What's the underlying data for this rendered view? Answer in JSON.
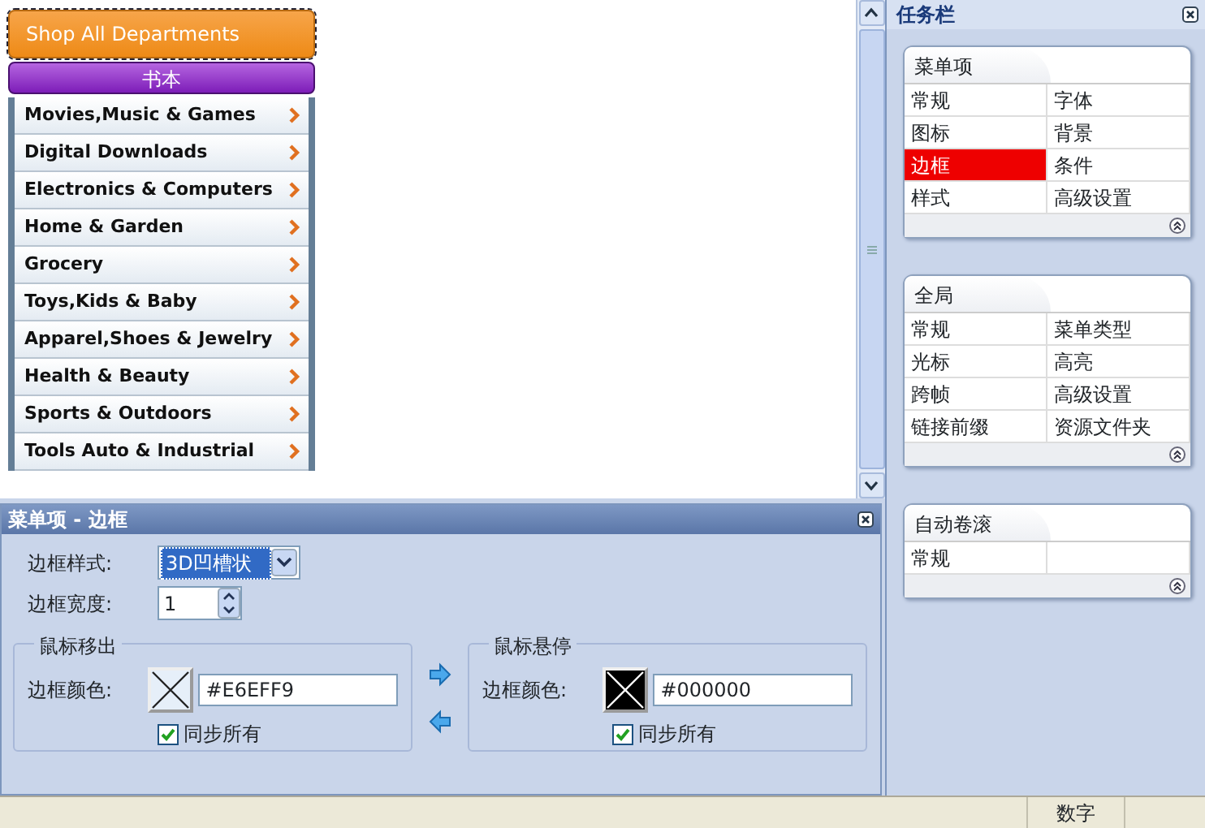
{
  "menu_preview": {
    "header_button": "Shop All Departments",
    "sub_button": "书本",
    "items": [
      {
        "label": "Movies,Music & Games"
      },
      {
        "label": "Digital Downloads"
      },
      {
        "label": "Electronics & Computers"
      },
      {
        "label": "Home & Garden"
      },
      {
        "label": "Grocery"
      },
      {
        "label": "Toys,Kids & Baby"
      },
      {
        "label": "Apparel,Shoes & Jewelry"
      },
      {
        "label": "Health & Beauty"
      },
      {
        "label": "Sports & Outdoors"
      },
      {
        "label": "Tools Auto & Industrial"
      }
    ]
  },
  "properties_panel": {
    "title": "菜单项 - 边框",
    "border_style": {
      "label": "边框样式:",
      "value": "3D凹槽状"
    },
    "border_width": {
      "label": "边框宽度:",
      "value": "1"
    },
    "groups": [
      {
        "title": "鼠标移出",
        "color_label": "边框颜色:",
        "color": "#e6eff9",
        "value": "#E6EFF9",
        "sync": {
          "label": "同步所有",
          "checked": true
        }
      },
      {
        "title": "鼠标悬停",
        "color_label": "边框颜色:",
        "color": "#000000",
        "value": "#000000",
        "sync": {
          "label": "同步所有",
          "checked": true
        }
      }
    ]
  },
  "task_pane": {
    "title": "任务栏",
    "groups": [
      {
        "title": "菜单项",
        "items": [
          {
            "label": "常规",
            "selected": false
          },
          {
            "label": "字体",
            "selected": false
          },
          {
            "label": "图标",
            "selected": false
          },
          {
            "label": "背景",
            "selected": false
          },
          {
            "label": "边框",
            "selected": true
          },
          {
            "label": "条件",
            "selected": false
          },
          {
            "label": "样式",
            "selected": false
          },
          {
            "label": "高级设置",
            "selected": false
          }
        ]
      },
      {
        "title": "全局",
        "items": [
          {
            "label": "常规",
            "selected": false
          },
          {
            "label": "菜单类型",
            "selected": false
          },
          {
            "label": "光标",
            "selected": false
          },
          {
            "label": "高亮",
            "selected": false
          },
          {
            "label": "跨帧",
            "selected": false
          },
          {
            "label": "高级设置",
            "selected": false
          },
          {
            "label": "链接前缀",
            "selected": false
          },
          {
            "label": "资源文件夹",
            "selected": false
          }
        ]
      },
      {
        "title": "自动卷滚",
        "items": [
          {
            "label": "常规",
            "selected": false
          }
        ]
      }
    ]
  },
  "status_bar": {
    "panels": [
      "数字"
    ]
  }
}
